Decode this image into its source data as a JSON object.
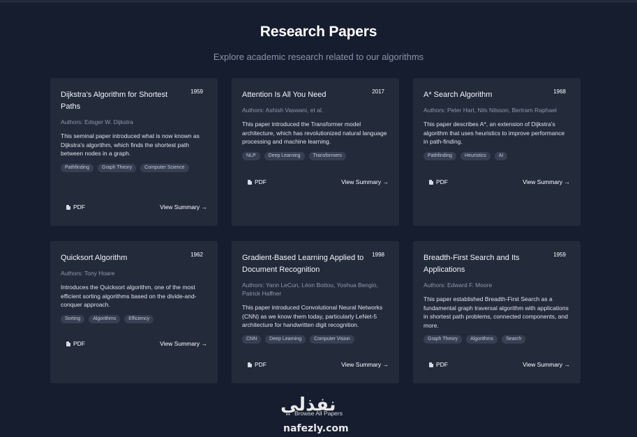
{
  "header": {
    "title": "Research Papers",
    "subtitle": "Explore academic research related to our algorithms"
  },
  "papers": [
    {
      "title": "Dijkstra's Algorithm for Shortest Paths",
      "year": "1959",
      "authors": "Authors: Edsger W. Dijkstra",
      "description": "This seminal paper introduced what is now known as Dijkstra's algorithm, which finds the shortest path between nodes in a graph.",
      "tags": [
        "Pathfinding",
        "Graph Theory",
        "Computer Science"
      ],
      "pdf_label": "PDF",
      "summary_label": "View Summary →"
    },
    {
      "title": "Attention Is All You Need",
      "year": "2017",
      "authors": "Authors: Ashish Vaswani, et al.",
      "description": "This paper introduced the Transformer model architecture, which has revolutionized natural language processing and machine learning.",
      "tags": [
        "NLP",
        "Deep Learning",
        "Transformers"
      ],
      "pdf_label": "PDF",
      "summary_label": "View Summary →"
    },
    {
      "title": "A* Search Algorithm",
      "year": "1968",
      "authors": "Authors: Peter Hart, Nils Nilsson, Bertram Raphael",
      "description": "This paper describes A*, an extension of Dijkstra's algorithm that uses heuristics to improve performance in path-finding.",
      "tags": [
        "Pathfinding",
        "Heuristics",
        "AI"
      ],
      "pdf_label": "PDF",
      "summary_label": "View Summary →"
    },
    {
      "title": "Quicksort Algorithm",
      "year": "1962",
      "authors": "Authors: Tony Hoare",
      "description": "Introduces the Quicksort algorithm, one of the most efficient sorting algorithms based on the divide-and-conquer approach.",
      "tags": [
        "Sorting",
        "Algorithms",
        "Efficiency"
      ],
      "pdf_label": "PDF",
      "summary_label": "View Summary →"
    },
    {
      "title": "Gradient-Based Learning Applied to Document Recognition",
      "year": "1998",
      "authors": "Authors: Yann LeCun, Léon Bottou, Yoshua Bengio, Patrick Haffner",
      "description": "This paper introduced Convolutional Neural Networks (CNN) as we know them today, particularly LeNet-5 architecture for handwritten digit recognition.",
      "tags": [
        "CNN",
        "Deep Learning",
        "Computer Vision"
      ],
      "pdf_label": "PDF",
      "summary_label": "View Summary →"
    },
    {
      "title": "Breadth-First Search and Its Applications",
      "year": "1959",
      "authors": "Authors: Edward F. Moore",
      "description": "This paper established Breadth-First Search as a fundamental graph traversal algorithm with applications in shortest path problems, connected components, and more.",
      "tags": [
        "Graph Theory",
        "Algorithms",
        "Search"
      ],
      "pdf_label": "PDF",
      "summary_label": "View Summary →"
    }
  ],
  "browse_label": "Browse All Papers",
  "watermark": {
    "arabic": "نفذلي",
    "latin": "nafezly.com"
  }
}
